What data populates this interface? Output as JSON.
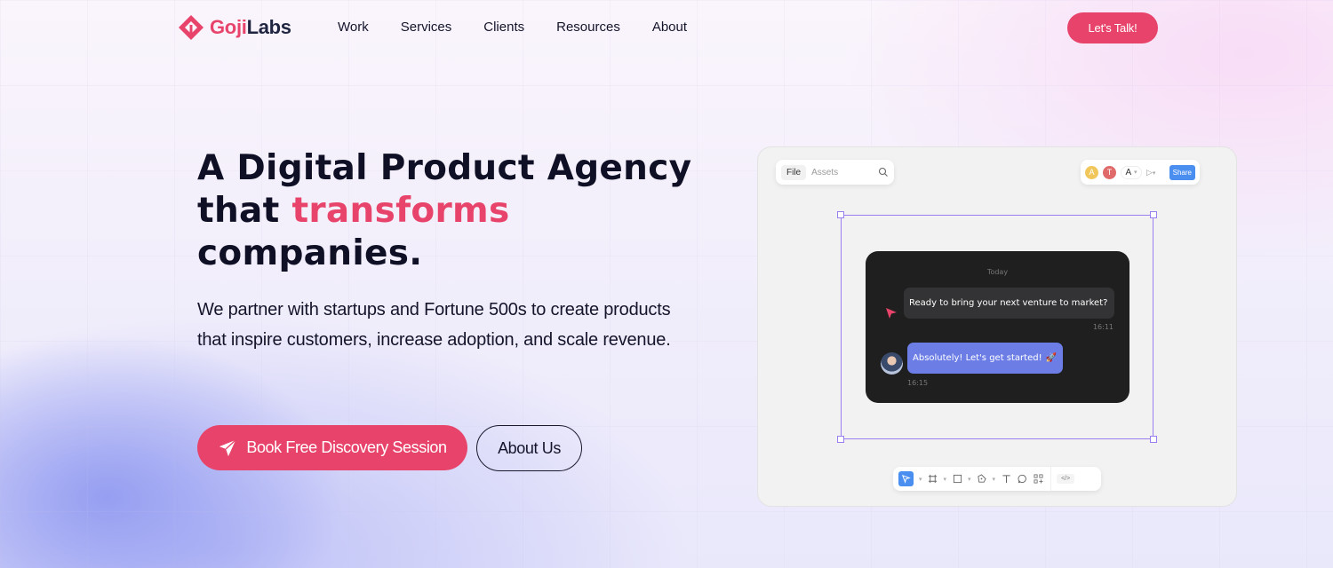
{
  "brand": {
    "name_part1": "Goji",
    "name_part2": "Labs",
    "accent_color": "#e8446b"
  },
  "nav": {
    "links": [
      "Work",
      "Services",
      "Clients",
      "Resources",
      "About"
    ],
    "cta_label": "Let's Talk!"
  },
  "hero": {
    "headline_line1": "A Digital Product Agency",
    "headline_line2_plain": "that ",
    "headline_line2_accent": "transforms",
    "headline_line3": "companies.",
    "subtext": "We partner with startups and Fortune 500s to create products that inspire customers, increase adoption, and scale revenue.",
    "primary_cta": "Book Free Discovery Session",
    "secondary_cta": "About Us"
  },
  "mockup": {
    "file_tab": "File",
    "assets_tab": "Assets",
    "collaborators": [
      "A",
      "T"
    ],
    "self_avatar": "A",
    "share_label": "Share",
    "chat": {
      "day_label": "Today",
      "message1": "Ready to bring your next venture to market?",
      "time1": "16:11",
      "message2": "Absolutely! Let's get started!",
      "time2": "16:15"
    },
    "code_label": "</>",
    "toolbar_tools": [
      "move-tool",
      "frame-tool",
      "rectangle-tool",
      "pen-tool",
      "text-tool",
      "comment-tool",
      "components-tool"
    ]
  }
}
